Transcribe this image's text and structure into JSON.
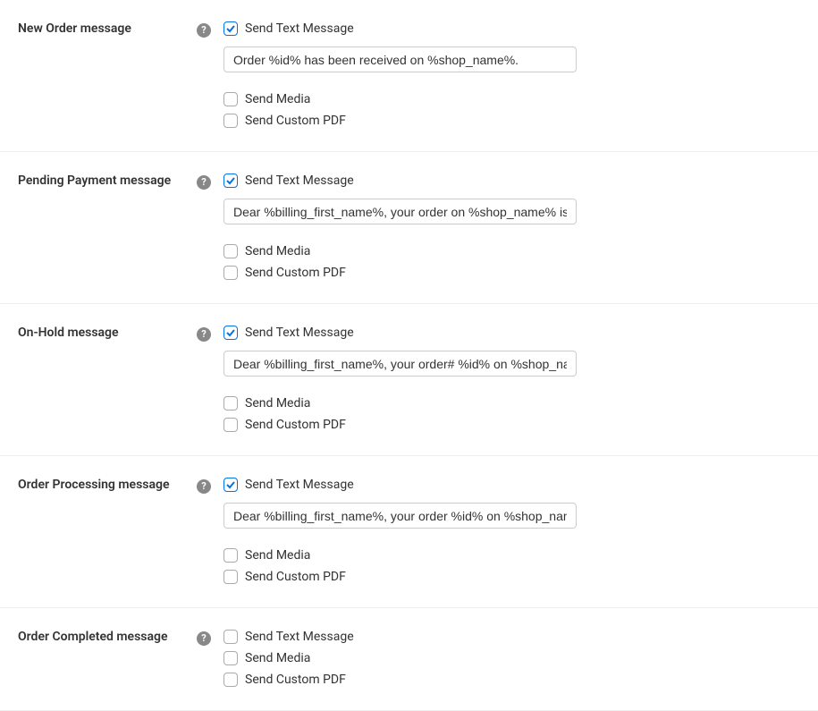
{
  "labels": {
    "send_text_message": "Send Text Message",
    "send_media": "Send Media",
    "send_custom_pdf": "Send Custom PDF"
  },
  "new_order": {
    "title": "New Order message",
    "send_text_checked": true,
    "text_value": "Order %id% has been received on %shop_name%.",
    "send_media_checked": false,
    "send_custom_pdf_checked": false
  },
  "pending_payment": {
    "title": "Pending Payment message",
    "send_text_checked": true,
    "text_value": "Dear %billing_first_name%, your order on %shop_name% is",
    "send_media_checked": false,
    "send_custom_pdf_checked": false
  },
  "on_hold": {
    "title": "On-Hold message",
    "send_text_checked": true,
    "text_value": "Dear %billing_first_name%, your order# %id% on %shop_na",
    "send_media_checked": false,
    "send_custom_pdf_checked": false
  },
  "order_processing": {
    "title": "Order Processing message",
    "send_text_checked": true,
    "text_value": "Dear %billing_first_name%, your order %id% on %shop_nam",
    "send_media_checked": false,
    "send_custom_pdf_checked": false
  },
  "order_completed": {
    "title": "Order Completed message",
    "send_text_checked": false,
    "send_media_checked": false,
    "send_custom_pdf_checked": false
  }
}
